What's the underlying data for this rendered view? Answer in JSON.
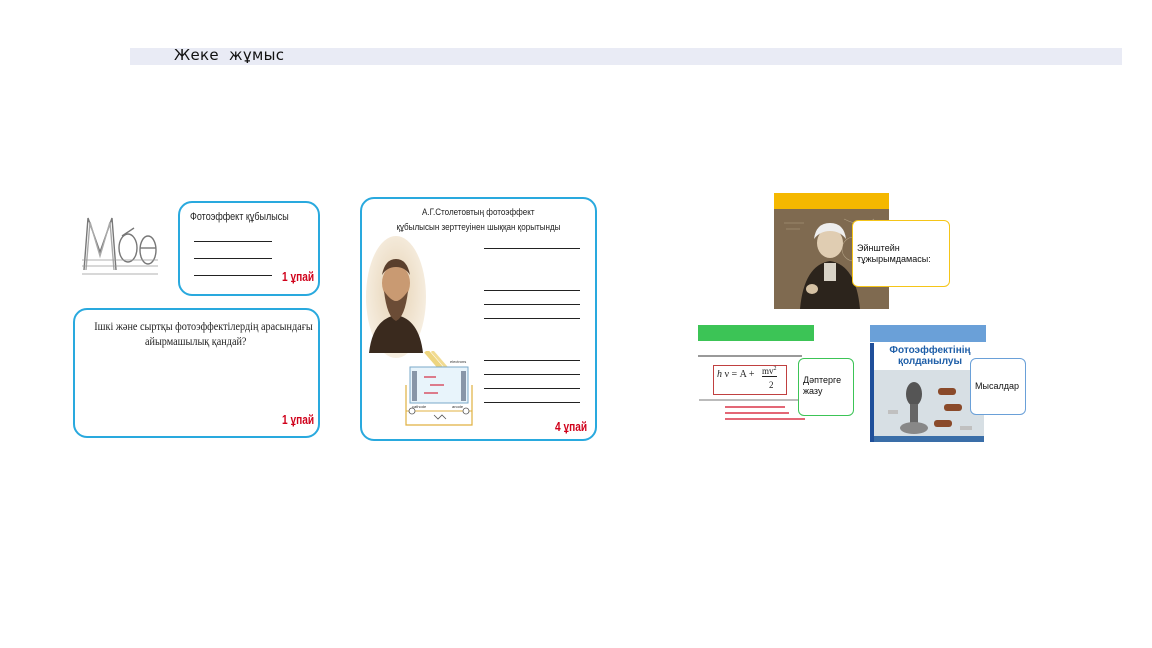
{
  "header": {
    "title": "Жеке  жұмыс"
  },
  "card1": {
    "title": "Фотоэффект құбылысы",
    "score": "1 ұпай"
  },
  "card2": {
    "question_line1": "Ішкі және сыртқы фотоэффектілердің арасындағы",
    "question_line2": "айырмашылық қандай?",
    "score": "1 ұпай"
  },
  "card3": {
    "title_line1": "А.Г.Столетовтың фотоэффект",
    "title_line2": "құбылысын зерттеуінен шыққан қорытынды",
    "score": "4 ұпай",
    "diagram_labels": {
      "top": "electrons",
      "cathode": "cathode",
      "anode": "anode"
    }
  },
  "slide_einstein": {
    "callout": "Эйнштейн тұжырымдамасы:"
  },
  "slide_formula": {
    "callout": "Дәптерге жазу",
    "formula": {
      "h": "h",
      "v": "ν",
      "eq": "=",
      "A": "A",
      "plus": "+",
      "num": "mv",
      "exp": "2",
      "den": "2"
    }
  },
  "slide_apps": {
    "title_line1": "Фотоэффектінің",
    "title_line2": "қолданылуы",
    "callout": "Мысалдар"
  },
  "colors": {
    "card_border": "#29a9de",
    "score": "#d0021b",
    "header_bar": "#e9ebf5",
    "einstein_header": "#f5b800",
    "formula_header": "#3cc456",
    "apps_header": "#6aa0d8",
    "apps_title": "#1f5fa8"
  }
}
